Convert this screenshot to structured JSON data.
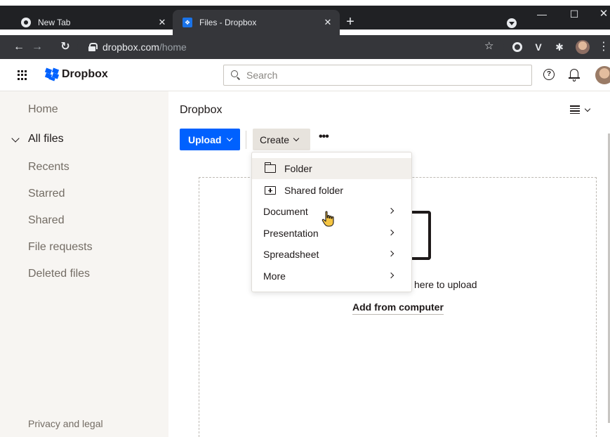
{
  "browser": {
    "tabs": [
      {
        "title": "New Tab",
        "active": false
      },
      {
        "title": "Files - Dropbox",
        "active": true
      }
    ],
    "url_host": "dropbox.com",
    "url_path": "/home"
  },
  "header": {
    "logo_text": "Dropbox",
    "search_placeholder": "Search",
    "help_glyph": "?"
  },
  "sidebar": {
    "items": [
      {
        "label": "Home",
        "active": false
      },
      {
        "label": "All files",
        "active": true
      },
      {
        "label": "Recents",
        "active": false
      },
      {
        "label": "Starred",
        "active": false
      },
      {
        "label": "Shared",
        "active": false
      },
      {
        "label": "File requests",
        "active": false
      },
      {
        "label": "Deleted files",
        "active": false
      }
    ],
    "footer": "Privacy and legal"
  },
  "main": {
    "breadcrumb": "Dropbox",
    "upload_label": "Upload",
    "create_label": "Create",
    "more_label": "•••",
    "drop_text": "here to upload",
    "add_link": "Add from computer"
  },
  "create_menu": {
    "items": [
      {
        "label": "Folder",
        "icon": "folder-icon",
        "submenu": false
      },
      {
        "label": "Shared folder",
        "icon": "shared-folder-icon",
        "submenu": false
      },
      {
        "label": "Document",
        "icon": "",
        "submenu": true
      },
      {
        "label": "Presentation",
        "icon": "",
        "submenu": true
      },
      {
        "label": "Spreadsheet",
        "icon": "",
        "submenu": true
      },
      {
        "label": "More",
        "icon": "",
        "submenu": true
      }
    ]
  },
  "colors": {
    "accent": "#0061fe",
    "sidebar_bg": "#f7f5f2",
    "create_bg": "#e7e3dd"
  }
}
